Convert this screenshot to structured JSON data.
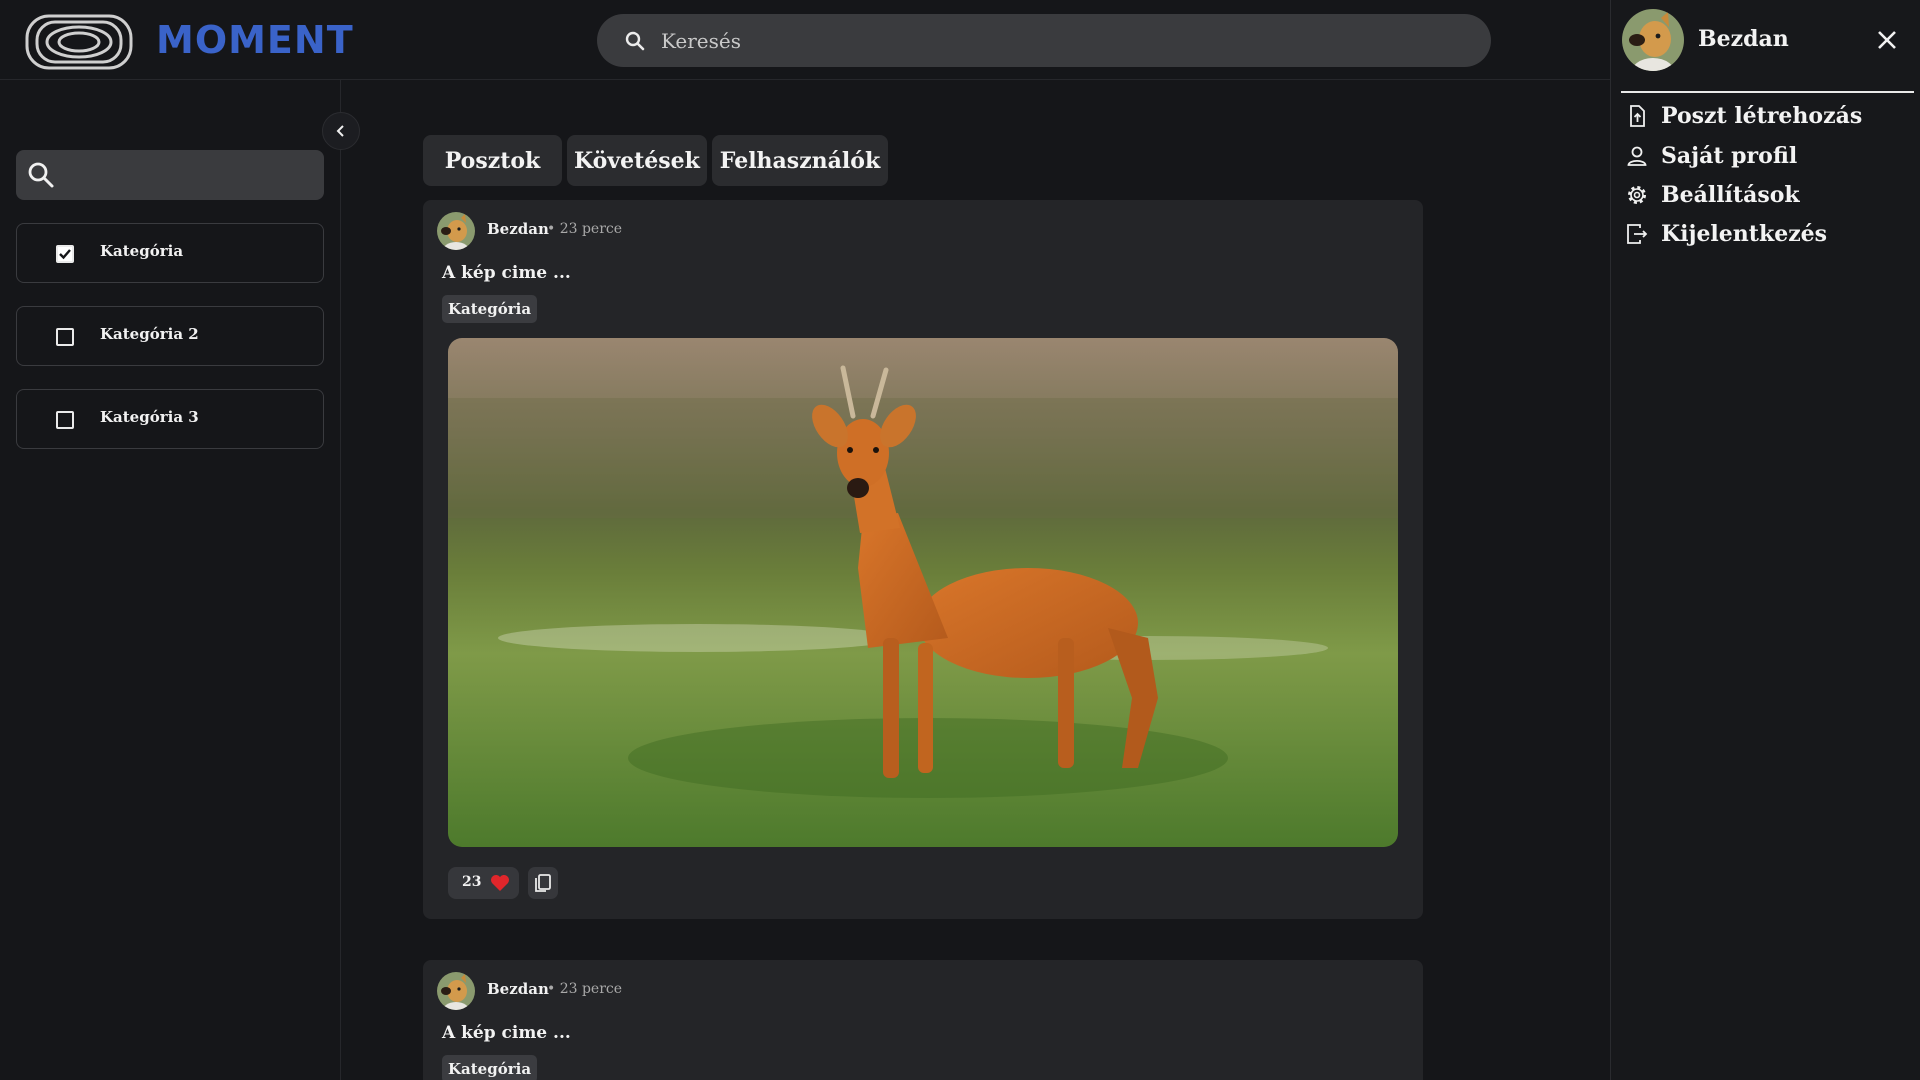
{
  "header": {
    "brand": "MOMENT",
    "search_placeholder": "Keresés"
  },
  "sidebar": {
    "search_value": "",
    "categories": [
      {
        "label": "Kategória",
        "checked": true
      },
      {
        "label": "Kategória 2",
        "checked": false
      },
      {
        "label": "Kategória 3",
        "checked": false
      }
    ]
  },
  "tabs": [
    {
      "label": "Posztok"
    },
    {
      "label": "Követések"
    },
    {
      "label": "Felhasználók"
    }
  ],
  "posts": [
    {
      "author": "Bezdan",
      "time": "• 23 perce",
      "title": "A kép cime ...",
      "category": "Kategória",
      "likes": "23"
    },
    {
      "author": "Bezdan",
      "time": "• 23 perce",
      "title": "A kép cime ...",
      "category": "Kategória"
    }
  ],
  "user_panel": {
    "username": "Bezdan",
    "menu": [
      {
        "label": "Poszt létrehozás",
        "icon": "file-upload-icon"
      },
      {
        "label": "Saját profil",
        "icon": "user-icon"
      },
      {
        "label": "Beállítások",
        "icon": "gear-icon"
      },
      {
        "label": "Kijelentkezés",
        "icon": "logout-icon"
      }
    ]
  },
  "colors": {
    "background": "#151619",
    "brand": "#3a63c9",
    "card": "#242528",
    "heart": "#e0262b"
  }
}
